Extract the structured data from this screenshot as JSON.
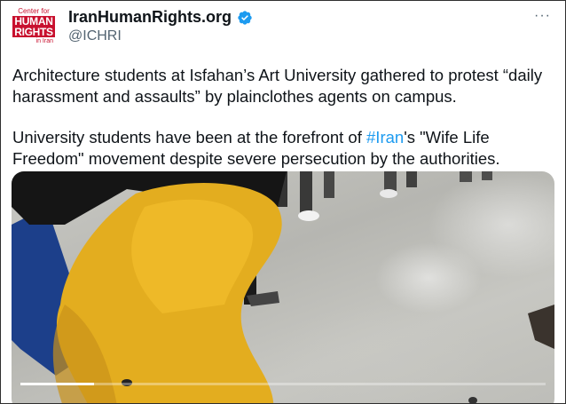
{
  "account": {
    "logo_text_top": "Center for",
    "logo_text_main": "HUMAN\nRIGHTS",
    "logo_text_bottom": "in Iran",
    "display_name": "IranHumanRights.org",
    "handle": "@ICHRI",
    "verified": true
  },
  "tweet": {
    "paragraph1": "Architecture students at Isfahan’s Art University gathered to protest “daily harassment and assaults” by plainclothes agents on campus.",
    "paragraph2_before": "University students have been at the forefront of ",
    "hashtag": "#Iran",
    "paragraph2_after": "'s \"Wife Life Freedom\" movement despite severe persecution by the authorities."
  },
  "menu": {
    "more_label": "···"
  },
  "video": {
    "progress": 0.14
  },
  "colors": {
    "brand_red": "#c8102e",
    "link_blue": "#1d9bf0",
    "verified_blue": "#1d9bf0"
  },
  "icons": {
    "verified": "verified-badge-icon",
    "more": "more-icon"
  }
}
